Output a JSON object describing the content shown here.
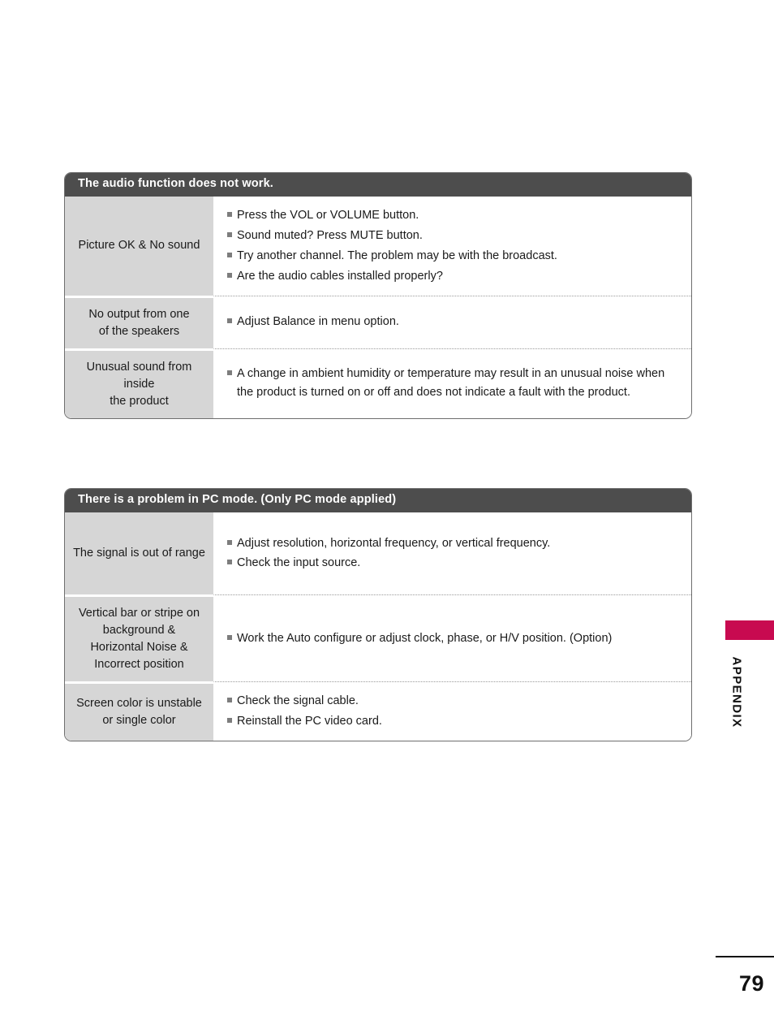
{
  "page": {
    "number": "79",
    "section_label": "APPENDIX"
  },
  "tables": [
    {
      "id": "audio",
      "header": "The audio function does not work.",
      "rows": [
        {
          "label_lines": [
            "Picture OK & No sound"
          ],
          "bullets": [
            "Press the VOL or VOLUME button.",
            "Sound muted? Press MUTE button.",
            "Try another channel. The problem may be with the broadcast.",
            "Are the audio cables installed properly?"
          ]
        },
        {
          "label_lines": [
            "No output from one",
            "of the speakers"
          ],
          "bullets": [
            "Adjust Balance in menu option."
          ]
        },
        {
          "label_lines": [
            "Unusual sound from",
            "inside",
            "the product"
          ],
          "bullets": [
            "A change in ambient humidity or temperature may result in an unusual noise when the product is turned on or off and does not indicate a fault with the product."
          ]
        }
      ]
    },
    {
      "id": "pcmode",
      "header": "There is a problem in PC mode. (Only PC mode applied)",
      "rows": [
        {
          "label_lines": [
            "The signal is out of range"
          ],
          "bullets": [
            "Adjust resolution, horizontal frequency, or vertical frequency.",
            "Check the input source."
          ]
        },
        {
          "label_lines": [
            "Vertical bar or stripe on",
            "background &",
            "Horizontal Noise &",
            "Incorrect position"
          ],
          "bullets": [
            "Work the Auto configure or adjust clock, phase, or H/V position. (Option)"
          ]
        },
        {
          "label_lines": [
            "Screen color is unstable",
            "or single color"
          ],
          "bullets": [
            "Check the signal cable.",
            "Reinstall the PC video card."
          ]
        }
      ]
    }
  ],
  "colors": {
    "header_bar": "#4d4d4d",
    "label_cell": "#d6d6d6",
    "accent_tab": "#c80a50",
    "bullet": "#7d7d7d"
  }
}
